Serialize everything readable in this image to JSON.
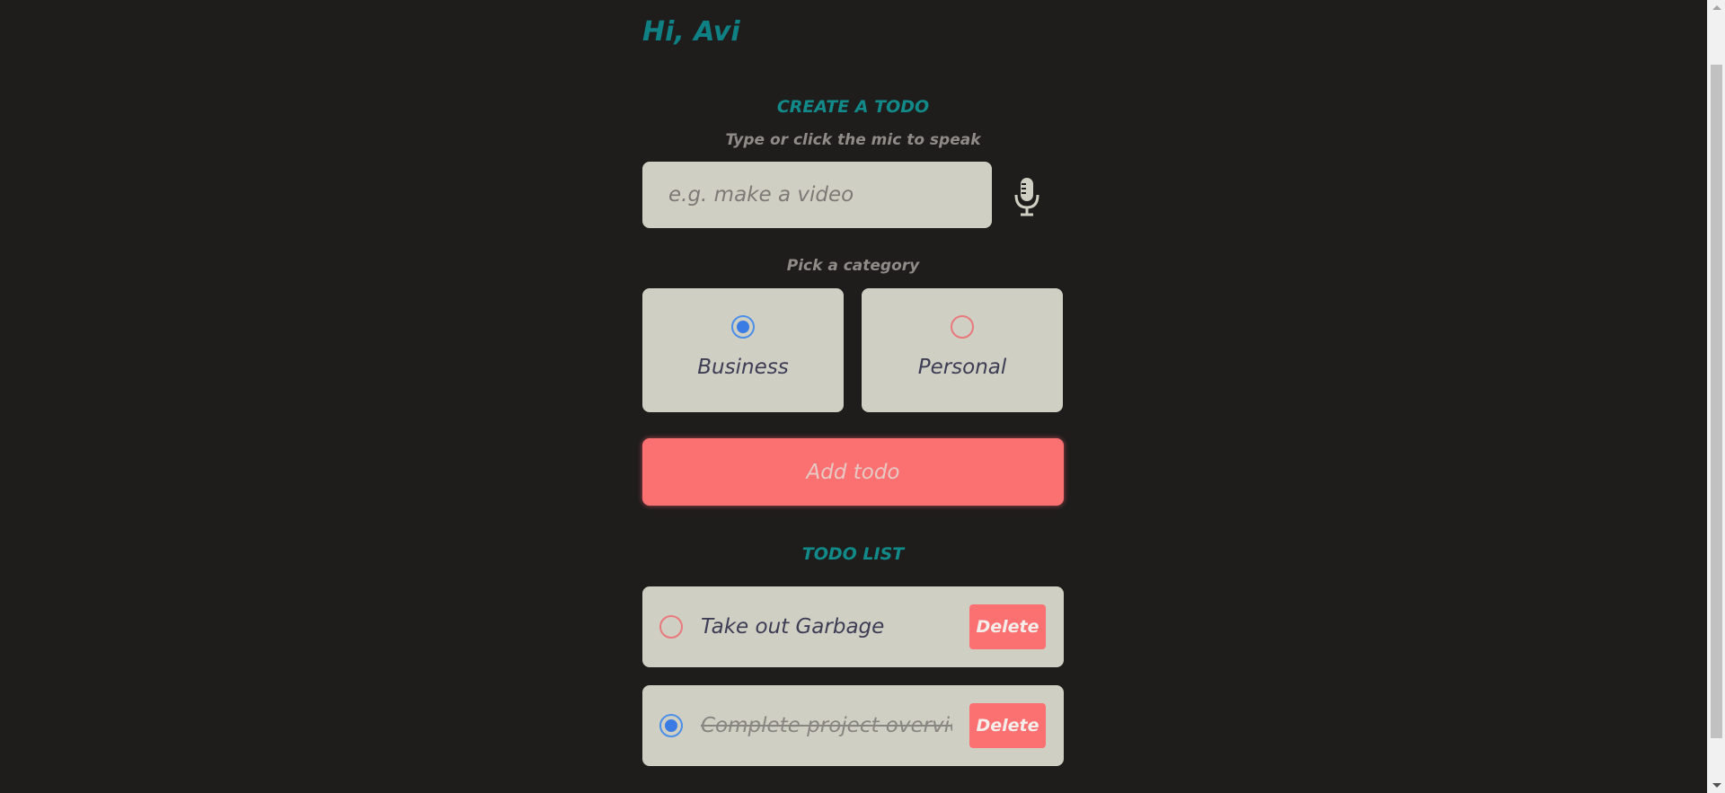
{
  "greeting": "Hi, Avi",
  "create_section": {
    "title": "CREATE A TODO",
    "hint": "Type or click the mic to speak",
    "input_placeholder": "e.g. make a video",
    "input_value": "",
    "mic_icon": "microphone-icon",
    "category_hint": "Pick a category",
    "categories": [
      {
        "label": "Business",
        "selected": true,
        "color": "#3a7ce3"
      },
      {
        "label": "Personal",
        "selected": false,
        "color": "#e8797c"
      }
    ],
    "add_button_label": "Add todo"
  },
  "list_section": {
    "title": "TODO LIST",
    "items": [
      {
        "text": "Take out Garbage",
        "done": false,
        "delete_label": "Delete"
      },
      {
        "text": "Complete project overview",
        "done": true,
        "delete_label": "Delete"
      }
    ]
  },
  "colors": {
    "background": "#1e1d1c",
    "accent_teal": "#0f8184",
    "card": "#d0cfc3",
    "button_red": "#fb7172"
  }
}
